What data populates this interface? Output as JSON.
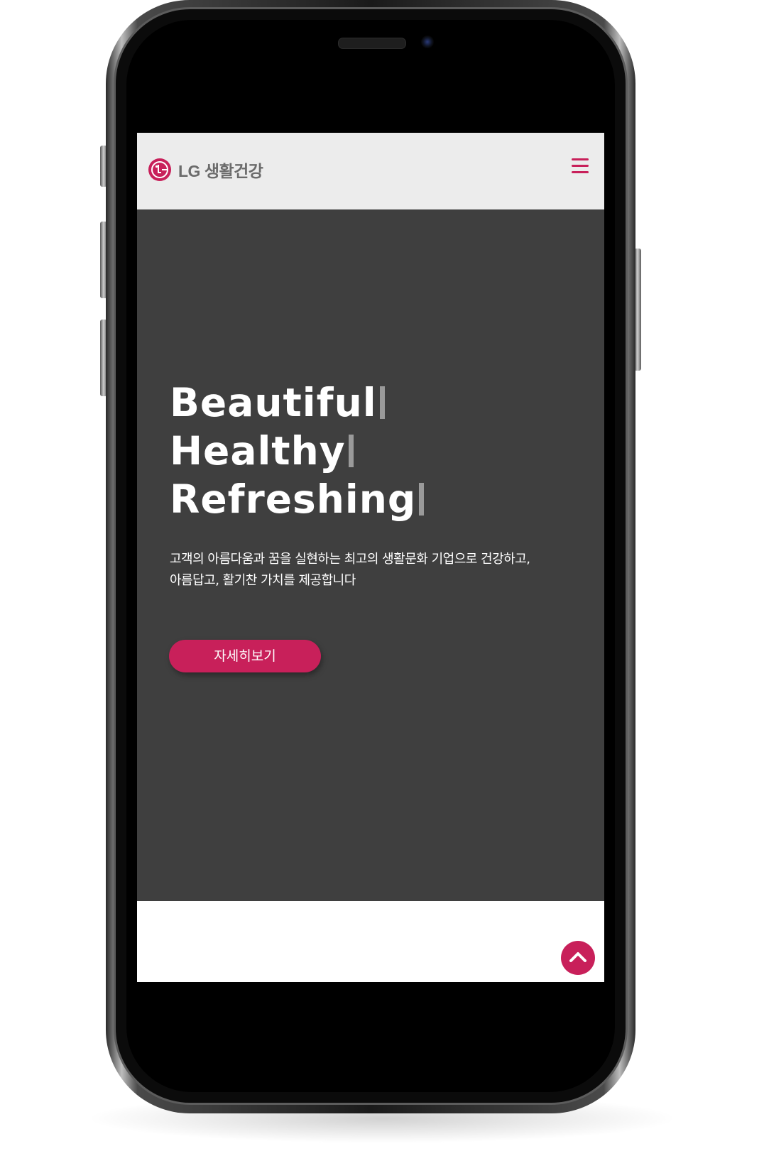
{
  "brand": {
    "name": "LG 생활건강",
    "accent_color": "#c8205a",
    "header_bg": "#ececec",
    "hero_bg": "#3f3f3f"
  },
  "header": {
    "logo_text": "LG 생활건강",
    "logo_icon": "lg-logo-icon",
    "menu_icon": "hamburger-menu-icon"
  },
  "hero": {
    "words": [
      "Beautiful",
      "Healthy",
      "Refreshing"
    ],
    "description": "고객의 아름다움과 꿈을 실현하는 최고의 생활문화 기업으로 건강하고, 아름답고, 활기찬 가치를 제공합니다",
    "cta_label": "자세히보기"
  },
  "floating": {
    "scroll_top_icon": "chevron-up-icon"
  }
}
